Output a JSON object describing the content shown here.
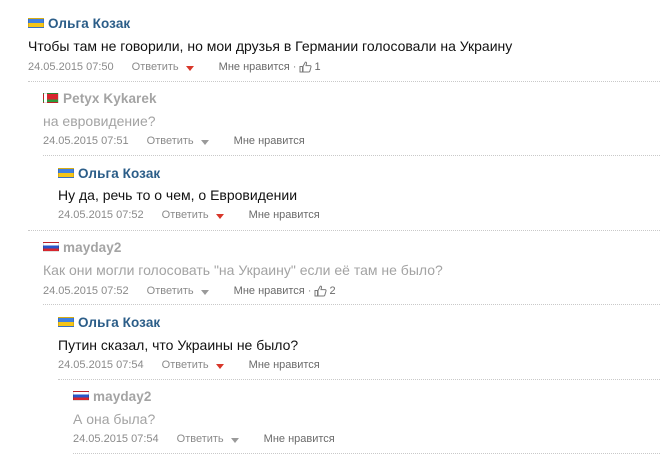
{
  "labels": {
    "reply": "Ответить",
    "like": "Мне нравится",
    "separator": "·"
  },
  "comments": [
    {
      "author": "Ольга Козак",
      "flag": "ukraine-flag",
      "text": "Чтобы там не говорили, но мои друзья в Германии голосовали на Украину",
      "date": "24.05.2015 07:50",
      "likes": "1"
    },
    {
      "author": "Petyx Kykarek",
      "flag": "belarus-flag",
      "text": "на евровидение?",
      "date": "24.05.2015 07:51"
    },
    {
      "author": "Ольга Козак",
      "flag": "ukraine-flag",
      "text": "Ну да, речь то о чем, о Евровидении",
      "date": "24.05.2015 07:52"
    },
    {
      "author": "mayday2",
      "flag": "russia-flag",
      "text": "Как они могли голосовать \"на Украину\" если её там не было?",
      "date": "24.05.2015 07:52",
      "likes": "2"
    },
    {
      "author": "Ольга Козак",
      "flag": "ukraine-flag",
      "text": "Путин сказал, что Украины не было?",
      "date": "24.05.2015 07:54"
    },
    {
      "author": "mayday2",
      "flag": "russia-flag",
      "text": "А она была?",
      "date": "24.05.2015 07:54"
    }
  ]
}
